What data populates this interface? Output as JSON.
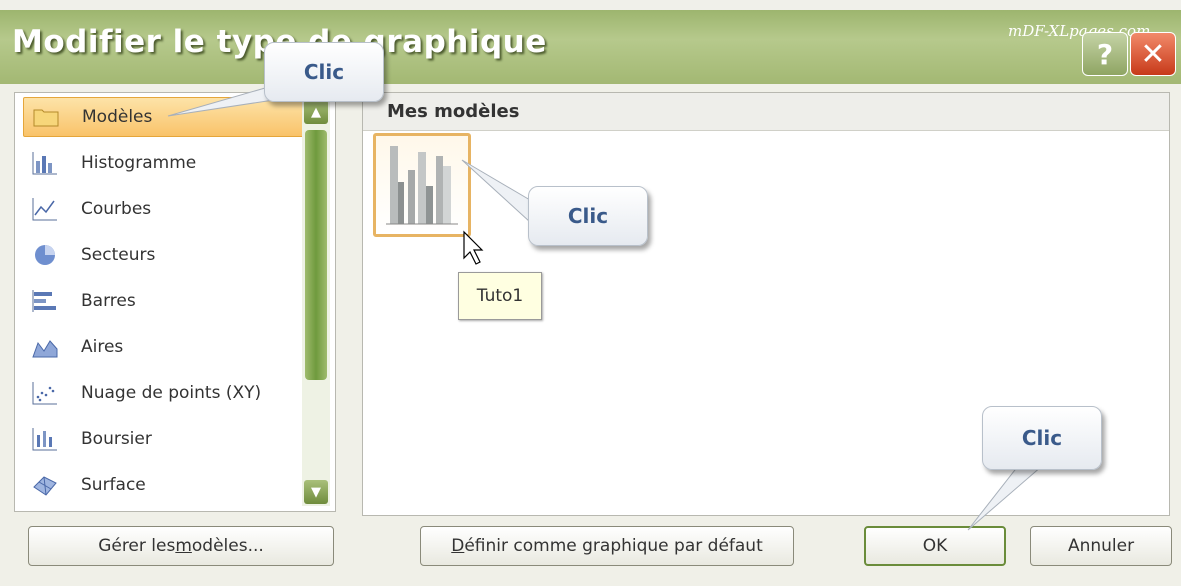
{
  "dialog": {
    "title": "Modifier le type de graphique",
    "watermark": "mDF-XLpages.com",
    "help_label": "?",
    "close_label": "✕"
  },
  "chart_types": [
    {
      "label": "Modèles",
      "icon": "folder-icon",
      "selected": true
    },
    {
      "label": "Histogramme",
      "icon": "column-chart-icon"
    },
    {
      "label": "Courbes",
      "icon": "line-chart-icon"
    },
    {
      "label": "Secteurs",
      "icon": "pie-chart-icon"
    },
    {
      "label": "Barres",
      "icon": "bar-chart-icon"
    },
    {
      "label": "Aires",
      "icon": "area-chart-icon"
    },
    {
      "label": "Nuage de points (XY)",
      "icon": "scatter-chart-icon"
    },
    {
      "label": "Boursier",
      "icon": "stock-chart-icon"
    },
    {
      "label": "Surface",
      "icon": "surface-chart-icon"
    }
  ],
  "templates_panel": {
    "header": "Mes modèles",
    "tooltip": "Tuto1"
  },
  "buttons": {
    "manage_prefix": "Gérer les ",
    "manage_underlined": "m",
    "manage_suffix": "odèles...",
    "default_underlined": "D",
    "default_suffix": "éfinir comme graphique par défaut",
    "ok": "OK",
    "cancel": "Annuler"
  },
  "callouts": {
    "c1": "Clic",
    "c2": "Clic",
    "c3": "Clic"
  },
  "colors": {
    "titlebar": "#a3b873",
    "selection": "#f9c36a",
    "callout_text": "#3a5a8a"
  }
}
